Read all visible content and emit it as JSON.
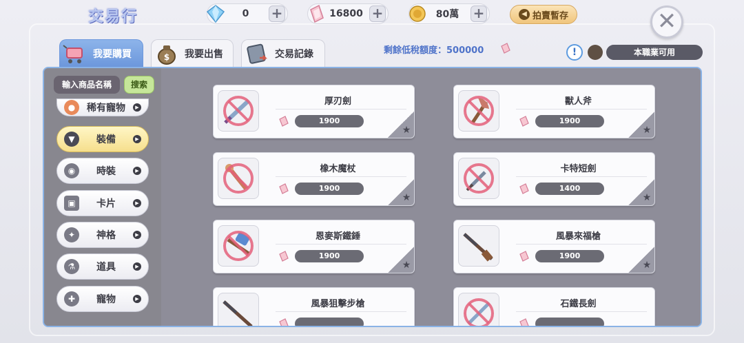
{
  "header": {
    "title": "交易行",
    "currencies": [
      {
        "name": "diamond",
        "value": "0",
        "color": "#7ec6f3"
      },
      {
        "name": "crystal",
        "value": "16800",
        "color": "#f2a3b4"
      },
      {
        "name": "zeny",
        "value": "80萬",
        "color": "#e6b64a"
      }
    ],
    "auction_button": "拍賣暫存",
    "close_icon": "close-icon"
  },
  "tabs": [
    {
      "label": "我要購買",
      "icon": "shopping-cart-icon",
      "active": true
    },
    {
      "label": "我要出售",
      "icon": "money-bag-icon",
      "active": false
    },
    {
      "label": "交易記錄",
      "icon": "record-book-icon",
      "active": false
    }
  ],
  "tax": {
    "label": "剩餘低稅額度：500000"
  },
  "job_filter": {
    "label": "本職業可用"
  },
  "search": {
    "placeholder": "輸入商品名稱",
    "button": "搜索"
  },
  "categories": [
    {
      "label": "稀有寵物",
      "icon": "pet-icon",
      "active": false
    },
    {
      "label": "裝備",
      "icon": "shirt-icon",
      "active": true
    },
    {
      "label": "時裝",
      "icon": "costume-icon",
      "active": false
    },
    {
      "label": "卡片",
      "icon": "card-icon",
      "active": false
    },
    {
      "label": "神格",
      "icon": "divinity-icon",
      "active": false
    },
    {
      "label": "道具",
      "icon": "potion-icon",
      "active": false
    },
    {
      "label": "寵物",
      "icon": "bone-icon",
      "active": false
    }
  ],
  "items": [
    {
      "name": "厚刃劍",
      "price": "1900",
      "restricted": true,
      "icon": "sword-icon"
    },
    {
      "name": "獸人斧",
      "price": "1900",
      "restricted": true,
      "icon": "axe-icon"
    },
    {
      "name": "橡木魔杖",
      "price": "1900",
      "restricted": true,
      "icon": "wand-icon"
    },
    {
      "name": "卡特短劍",
      "price": "1400",
      "restricted": true,
      "icon": "dagger-icon"
    },
    {
      "name": "恩麥斯鐵錘",
      "price": "1900",
      "restricted": true,
      "icon": "hammer-icon"
    },
    {
      "name": "風暴來福槍",
      "price": "1900",
      "restricted": false,
      "icon": "rifle-icon"
    },
    {
      "name": "風暴狙擊步槍",
      "price": "",
      "restricted": false,
      "icon": "sniper-rifle-icon"
    },
    {
      "name": "石鐵長劍",
      "price": "",
      "restricted": true,
      "icon": "longsword-icon"
    }
  ]
}
